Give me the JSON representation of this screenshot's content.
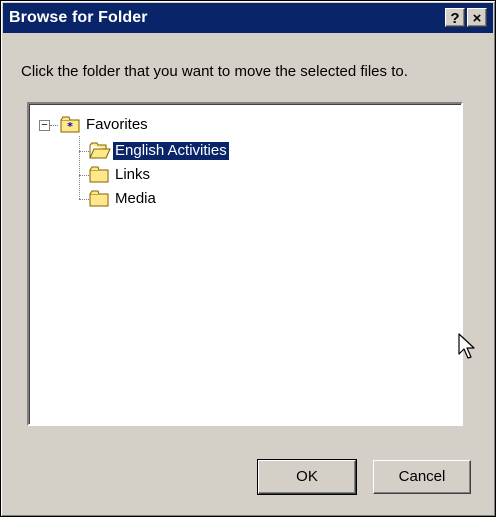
{
  "window": {
    "title": "Browse for Folder",
    "help_label": "?",
    "close_label": "×"
  },
  "instruction": "Click the folder that you want to move the selected files to.",
  "tree": {
    "expander_label": "−",
    "items": [
      {
        "label": "Favorites",
        "icon": "favorites-folder-icon",
        "expanded": true
      },
      {
        "label": "English Activities",
        "icon": "open-folder-icon",
        "selected": true
      },
      {
        "label": "Links",
        "icon": "folder-icon"
      },
      {
        "label": "Media",
        "icon": "folder-icon"
      }
    ]
  },
  "buttons": {
    "ok": "OK",
    "cancel": "Cancel"
  },
  "colors": {
    "titlebar": "#0a246a",
    "dialog_face": "#d4d0c8",
    "selection": "#0a246a",
    "folder": "#ffe88a"
  }
}
